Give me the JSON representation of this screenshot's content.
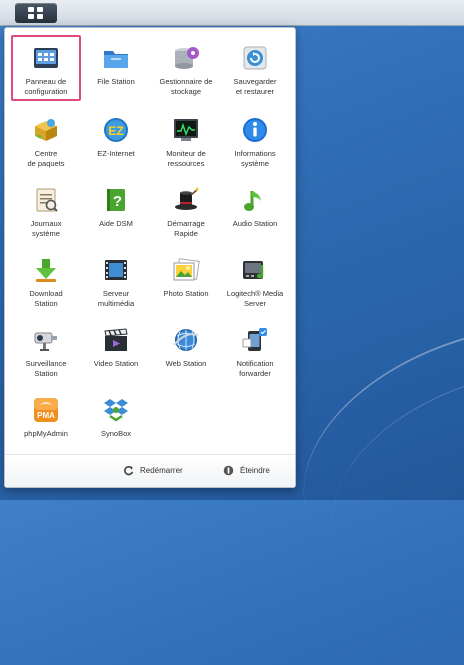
{
  "taskbar": {
    "main_menu_icon": "grid-menu-icon"
  },
  "apps": [
    {
      "name": "control-panel",
      "label": "Panneau de\nconfiguration",
      "icon": "control-panel-icon",
      "selected": true
    },
    {
      "name": "file-station",
      "label": "File Station",
      "icon": "folder-icon"
    },
    {
      "name": "storage-manager",
      "label": "Gestionnaire de\nstockage",
      "icon": "storage-icon"
    },
    {
      "name": "backup-restore",
      "label": "Sauvegarder\net restaurer",
      "icon": "backup-icon"
    },
    {
      "name": "package-center",
      "label": "Centre\nde paquets",
      "icon": "package-icon"
    },
    {
      "name": "ez-internet",
      "label": "EZ-Internet",
      "icon": "ez-icon"
    },
    {
      "name": "resource-monitor",
      "label": "Moniteur de\nressources",
      "icon": "monitor-icon"
    },
    {
      "name": "system-info",
      "label": "Informations\nsystème",
      "icon": "info-icon"
    },
    {
      "name": "system-logs",
      "label": "Journaux\nsystème",
      "icon": "log-icon"
    },
    {
      "name": "dsm-help",
      "label": "Aide DSM",
      "icon": "help-book-icon"
    },
    {
      "name": "quick-start",
      "label": "Démarrage\nRapide",
      "icon": "magic-hat-icon"
    },
    {
      "name": "audio-station",
      "label": "Audio Station",
      "icon": "music-note-icon"
    },
    {
      "name": "download-station",
      "label": "Download\nStation",
      "icon": "download-arrow-icon"
    },
    {
      "name": "media-server",
      "label": "Serveur\nmultimédia",
      "icon": "film-icon"
    },
    {
      "name": "photo-station",
      "label": "Photo Station",
      "icon": "photo-icon"
    },
    {
      "name": "logitech-media-server",
      "label": "Logitech® Media\nServer",
      "icon": "media-device-icon"
    },
    {
      "name": "surveillance-station",
      "label": "Surveillance\nStation",
      "icon": "camera-icon"
    },
    {
      "name": "video-station",
      "label": "Video Station",
      "icon": "clapperboard-icon"
    },
    {
      "name": "web-station",
      "label": "Web Station",
      "icon": "globe-icon"
    },
    {
      "name": "notification-forwarder",
      "label": "Notification\nforwarder",
      "icon": "notification-phone-icon"
    },
    {
      "name": "phpmyadmin",
      "label": "phpMyAdmin",
      "icon": "pma-icon"
    },
    {
      "name": "synobox",
      "label": "SynoBox",
      "icon": "dropbox-icon"
    }
  ],
  "footer": {
    "restart_label": "Redémarrer",
    "restart_icon": "restart-icon",
    "shutdown_label": "Éteindre",
    "shutdown_icon": "power-icon"
  },
  "colors": {
    "selected_border": "#e04a7b",
    "desktop": "#2f6db5"
  }
}
